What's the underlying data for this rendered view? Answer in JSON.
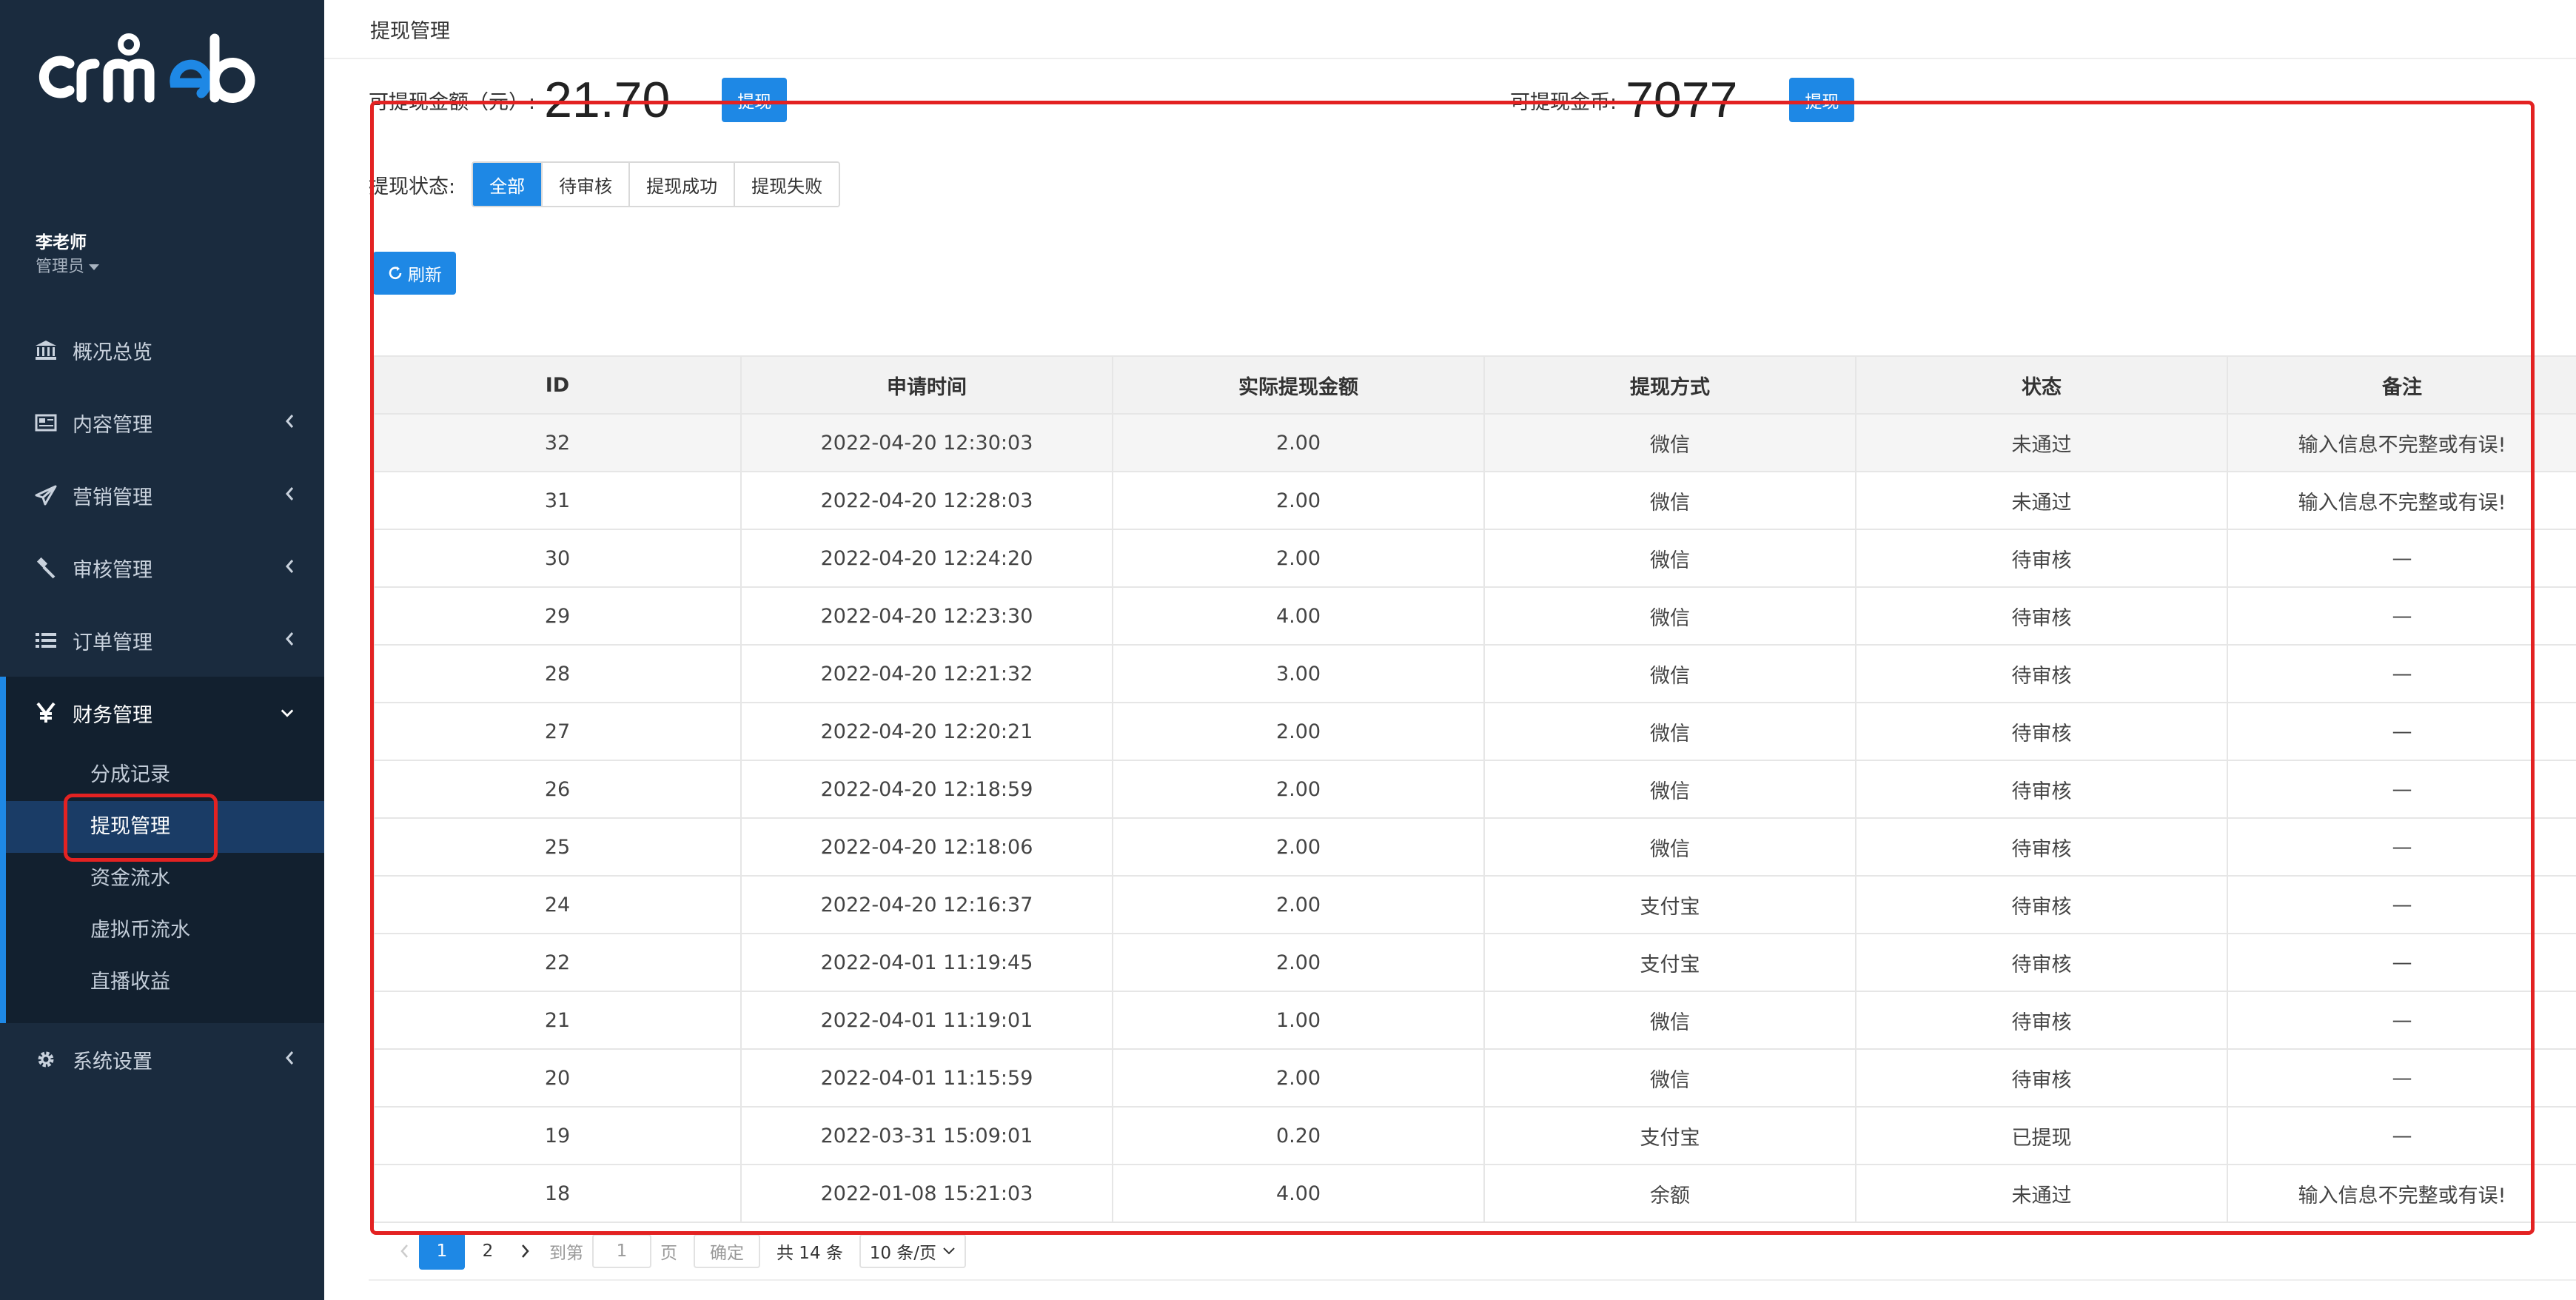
{
  "sidebar": {
    "logo_text": "crmeb",
    "user": {
      "name": "李老师",
      "role": "管理员"
    },
    "items": [
      {
        "label": "概况总览",
        "icon": "bank-icon"
      },
      {
        "label": "内容管理",
        "icon": "newspaper-icon"
      },
      {
        "label": "营销管理",
        "icon": "paper-plane-icon"
      },
      {
        "label": "审核管理",
        "icon": "gavel-icon"
      },
      {
        "label": "订单管理",
        "icon": "list-icon"
      },
      {
        "label": "财务管理",
        "icon": "yen-icon"
      },
      {
        "label": "系统设置",
        "icon": "gear-icon"
      }
    ],
    "finance_sub": [
      {
        "label": "分成记录"
      },
      {
        "label": "提现管理"
      },
      {
        "label": "资金流水"
      },
      {
        "label": "虚拟币流水"
      },
      {
        "label": "直播收益"
      }
    ]
  },
  "header": {
    "title": "提现管理"
  },
  "balance": {
    "cash_label": "可提现金额（元）:",
    "cash_value": "21.70",
    "coin_label": "可提现金币:",
    "coin_value": "7077",
    "withdraw_label": "提现"
  },
  "filter": {
    "label": "提现状态:",
    "options": [
      "全部",
      "待审核",
      "提现成功",
      "提现失败"
    ]
  },
  "refresh_label": "刷新",
  "table": {
    "columns": [
      "ID",
      "申请时间",
      "实际提现金额",
      "提现方式",
      "状态",
      "备注"
    ],
    "rows": [
      [
        "32",
        "2022-04-20 12:30:03",
        "2.00",
        "微信",
        "未通过",
        "输入信息不完整或有误!"
      ],
      [
        "31",
        "2022-04-20 12:28:03",
        "2.00",
        "微信",
        "未通过",
        "输入信息不完整或有误!"
      ],
      [
        "30",
        "2022-04-20 12:24:20",
        "2.00",
        "微信",
        "待审核",
        "—"
      ],
      [
        "29",
        "2022-04-20 12:23:30",
        "4.00",
        "微信",
        "待审核",
        "—"
      ],
      [
        "28",
        "2022-04-20 12:21:32",
        "3.00",
        "微信",
        "待审核",
        "—"
      ],
      [
        "27",
        "2022-04-20 12:20:21",
        "2.00",
        "微信",
        "待审核",
        "—"
      ],
      [
        "26",
        "2022-04-20 12:18:59",
        "2.00",
        "微信",
        "待审核",
        "—"
      ],
      [
        "25",
        "2022-04-20 12:18:06",
        "2.00",
        "微信",
        "待审核",
        "—"
      ],
      [
        "24",
        "2022-04-20 12:16:37",
        "2.00",
        "支付宝",
        "待审核",
        "—"
      ],
      [
        "22",
        "2022-04-01 11:19:45",
        "2.00",
        "支付宝",
        "待审核",
        "—"
      ],
      [
        "21",
        "2022-04-01 11:19:01",
        "1.00",
        "微信",
        "待审核",
        "—"
      ],
      [
        "20",
        "2022-04-01 11:15:59",
        "2.00",
        "微信",
        "待审核",
        "—"
      ],
      [
        "19",
        "2022-03-31 15:09:01",
        "0.20",
        "支付宝",
        "已提现",
        "—"
      ],
      [
        "18",
        "2022-01-08 15:21:03",
        "4.00",
        "余额",
        "未通过",
        "输入信息不完整或有误!"
      ]
    ]
  },
  "pager": {
    "pages": [
      "1",
      "2"
    ],
    "goto_label": "到第",
    "page_input": "1",
    "page_unit": "页",
    "confirm_label": "确定",
    "total_label": "共 14 条",
    "page_size": "10 条/页"
  },
  "colors": {
    "accent": "#1e88e5",
    "sidebar": "#1a2b3e",
    "highlight": "#e32222"
  }
}
